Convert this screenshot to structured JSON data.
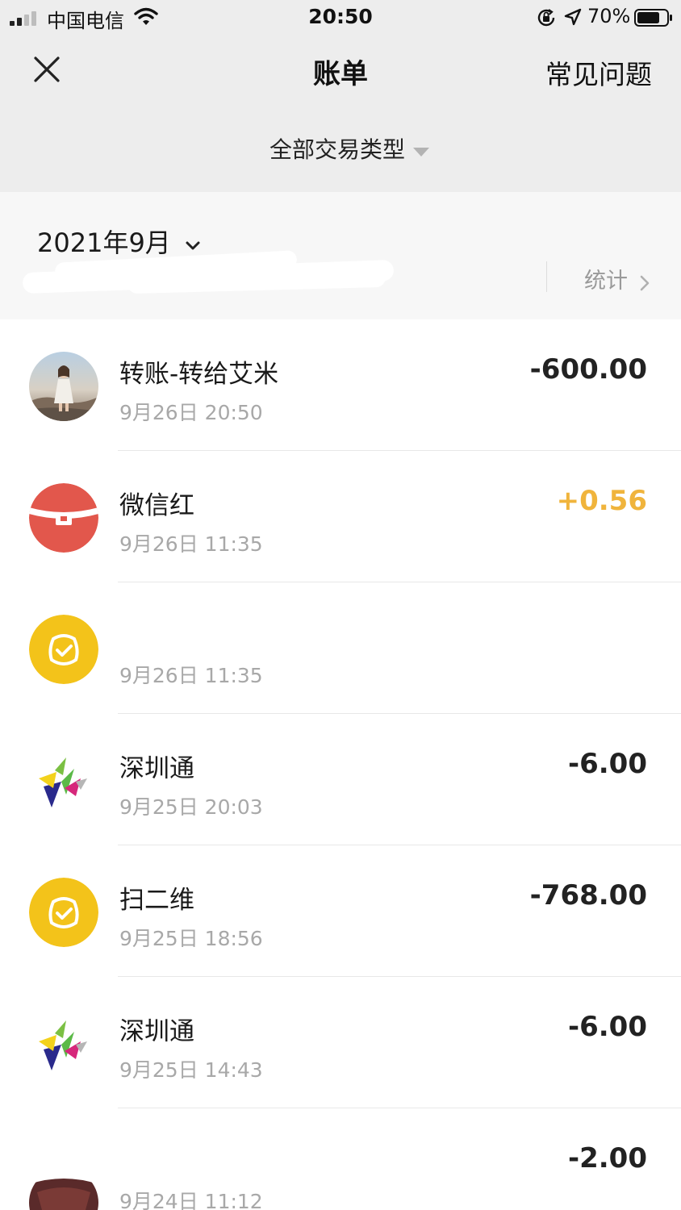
{
  "status_bar": {
    "carrier": "中国电信",
    "time": "20:50",
    "battery": "70%"
  },
  "nav": {
    "title": "账单",
    "faq": "常见问题"
  },
  "filter": {
    "label": "全部交易类型"
  },
  "month": {
    "label": "2021年9月",
    "stats": "统计"
  },
  "colors": {
    "income": "#f0b43c",
    "expense": "#222222",
    "redpacket": "#e2574c",
    "wallet": "#f3c31a"
  },
  "transactions": [
    {
      "icon": "avatar-photo",
      "title": "转账-转给艾米",
      "time": "9月26日 20:50",
      "amount": "-600.00",
      "type": "expense"
    },
    {
      "icon": "red-packet-icon",
      "title": "微信红",
      "time": "9月26日 11:35",
      "amount": "+0.56",
      "type": "income"
    },
    {
      "icon": "wallet-bag-icon",
      "title": "",
      "time": "9月26日 11:35",
      "amount": "",
      "type": "income"
    },
    {
      "icon": "shenzhentong-icon",
      "title": "深圳通",
      "time": "9月25日 20:03",
      "amount": "-6.00",
      "type": "expense"
    },
    {
      "icon": "wallet-bag-icon",
      "title": "扫二维",
      "time": "9月25日 18:56",
      "amount": "-768.00",
      "type": "expense"
    },
    {
      "icon": "shenzhentong-icon",
      "title": "深圳通",
      "time": "9月25日 14:43",
      "amount": "-6.00",
      "type": "expense"
    },
    {
      "icon": "merchant-photo",
      "title": "",
      "time": "9月24日 11:12",
      "amount": "-2.00",
      "type": "expense"
    }
  ]
}
